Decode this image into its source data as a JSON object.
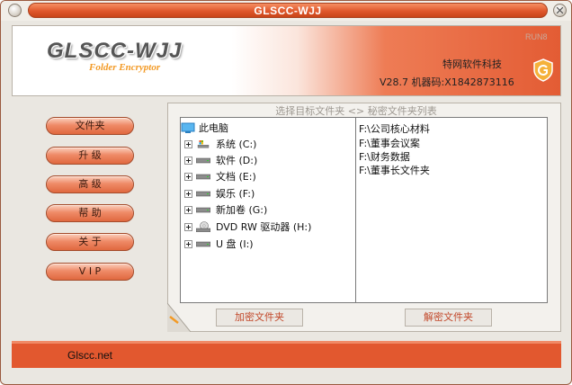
{
  "window": {
    "title": "GLSCC-WJJ"
  },
  "header": {
    "logo_text": "GLSCC-WJJ",
    "logo_subtitle": "Folder Encryptor",
    "run_label": "RUN8",
    "company": "特网软件科技",
    "version": "V28.7   机器码:X1842873116",
    "shield_icon": "g-shield-icon"
  },
  "nav": {
    "items": [
      {
        "label": "文件夹"
      },
      {
        "label": "升  级"
      },
      {
        "label": "高  级"
      },
      {
        "label": "帮  助"
      },
      {
        "label": "关  于"
      },
      {
        "label": "V  I  P"
      }
    ]
  },
  "panel": {
    "title": "选择目标文件夹 <> 秘密文件夹列表"
  },
  "tree": {
    "root": "此电脑",
    "drives": [
      {
        "label": "系统 (C:)",
        "icon": "system-drive-icon"
      },
      {
        "label": "软件 (D:)",
        "icon": "drive-icon"
      },
      {
        "label": "文档 (E:)",
        "icon": "drive-icon"
      },
      {
        "label": "娱乐 (F:)",
        "icon": "drive-icon"
      },
      {
        "label": "新加卷 (G:)",
        "icon": "drive-icon"
      },
      {
        "label": "DVD RW 驱动器 (H:)",
        "icon": "dvd-drive-icon"
      },
      {
        "label": "U 盘 (I:)",
        "icon": "drive-icon"
      }
    ]
  },
  "secret_list": {
    "items": [
      "F:\\公司核心材料",
      "F:\\董事会议案",
      "F:\\财务数据",
      "F:\\董事长文件夹"
    ]
  },
  "actions": {
    "encrypt_label": "加密文件夹",
    "decrypt_label": "解密文件夹"
  },
  "footer": {
    "text": "Glscc.net"
  },
  "colors": {
    "accent": "#e2582f",
    "button_text": "#c2482a"
  }
}
